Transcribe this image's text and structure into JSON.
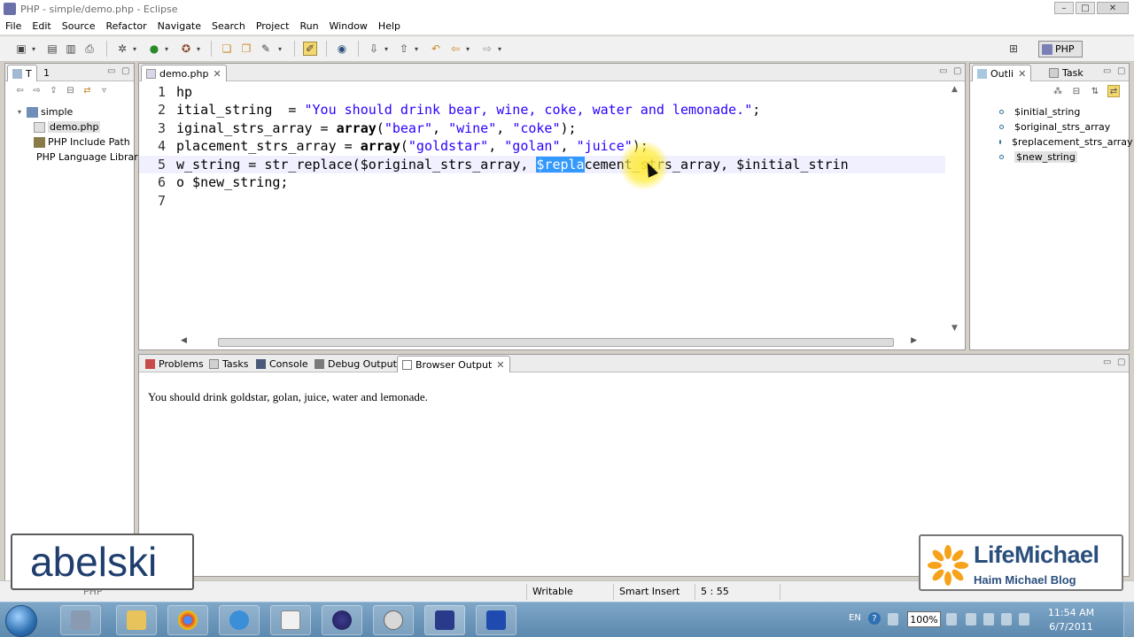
{
  "window": {
    "title": "PHP - simple/demo.php - Eclipse",
    "controls": [
      "–",
      "□",
      "✕"
    ]
  },
  "menu": [
    "File",
    "Edit",
    "Source",
    "Refactor",
    "Navigate",
    "Search",
    "Project",
    "Run",
    "Window",
    "Help"
  ],
  "perspective": {
    "label": "PHP"
  },
  "explorer": {
    "tabs": [
      "T",
      "1"
    ],
    "items": [
      {
        "label": "simple",
        "icon": "folder-icon"
      },
      {
        "label": "demo.php",
        "icon": "php-file-icon"
      },
      {
        "label": "PHP Include Path",
        "icon": "library-icon"
      },
      {
        "label": "PHP Language Library",
        "icon": "library-icon"
      }
    ]
  },
  "editor": {
    "tab": "demo.php",
    "lines": [
      {
        "num": "1",
        "text": "hp"
      },
      {
        "num": "2",
        "text": "itial_string  = \"You should drink bear, wine, coke, water and lemonade.\";"
      },
      {
        "num": "3",
        "text": "iginal_strs_array = array(\"bear\", \"wine\", \"coke\");"
      },
      {
        "num": "4",
        "text": "placement_strs_array = array(\"goldstar\", \"golan\", \"juice\");"
      },
      {
        "num": "5",
        "text": "w_string = str_replace($original_strs_array, $replacement_strs_array, $initial_strin"
      },
      {
        "num": "6",
        "text": "o $new_string;"
      },
      {
        "num": "7",
        "text": ""
      }
    ],
    "line2": {
      "code": "itial_string  = ",
      "str": "\"You should drink bear, wine, coke, water and lemonade.\"",
      "end": ";"
    },
    "line3": {
      "code": "iginal_strs_array = ",
      "kw": "array",
      "open": "(",
      "s1": "\"bear\"",
      "c1": ", ",
      "s2": "\"wine\"",
      "c2": ", ",
      "s3": "\"coke\"",
      "end": ");"
    },
    "line4": {
      "code": "placement_strs_array = ",
      "kw": "array",
      "open": "(",
      "s1": "\"goldstar\"",
      "c1": ", ",
      "s2": "\"golan\"",
      "c2": ", ",
      "s3": "\"juice\"",
      "end": ");"
    },
    "line5": {
      "code": "w_string = str_replace($original_strs_array, ",
      "hl": "$repla",
      "rest": "cement_strs_array, $initial_strin"
    }
  },
  "outline": {
    "tabs": [
      "Outli",
      "Task"
    ],
    "items": [
      "$initial_string",
      "$original_strs_array",
      "$replacement_strs_array",
      "$new_string"
    ],
    "selected": "$new_string"
  },
  "console": {
    "tabs": [
      "Problems",
      "Tasks",
      "Console",
      "Debug Output",
      "Browser Output"
    ],
    "output": "You should drink goldstar, golan, juice, water and lemonade."
  },
  "status": {
    "left": "PHP",
    "mode": "Writable",
    "insert": "Smart Insert",
    "position": "5 : 55"
  },
  "watermarks": {
    "left": "abelski",
    "right_brand": "LifeMichael",
    "right_sub": "Haim Michael Blog"
  },
  "taskbar": {
    "lang": "EN",
    "help": "?",
    "battery": "100%",
    "time": "11:54 AM",
    "date": "6/7/2011"
  },
  "colors": {
    "string": "#2a00ff",
    "selection": "#3399ff",
    "highlight": "#f5d86d",
    "brand": "#2a4f7d"
  }
}
